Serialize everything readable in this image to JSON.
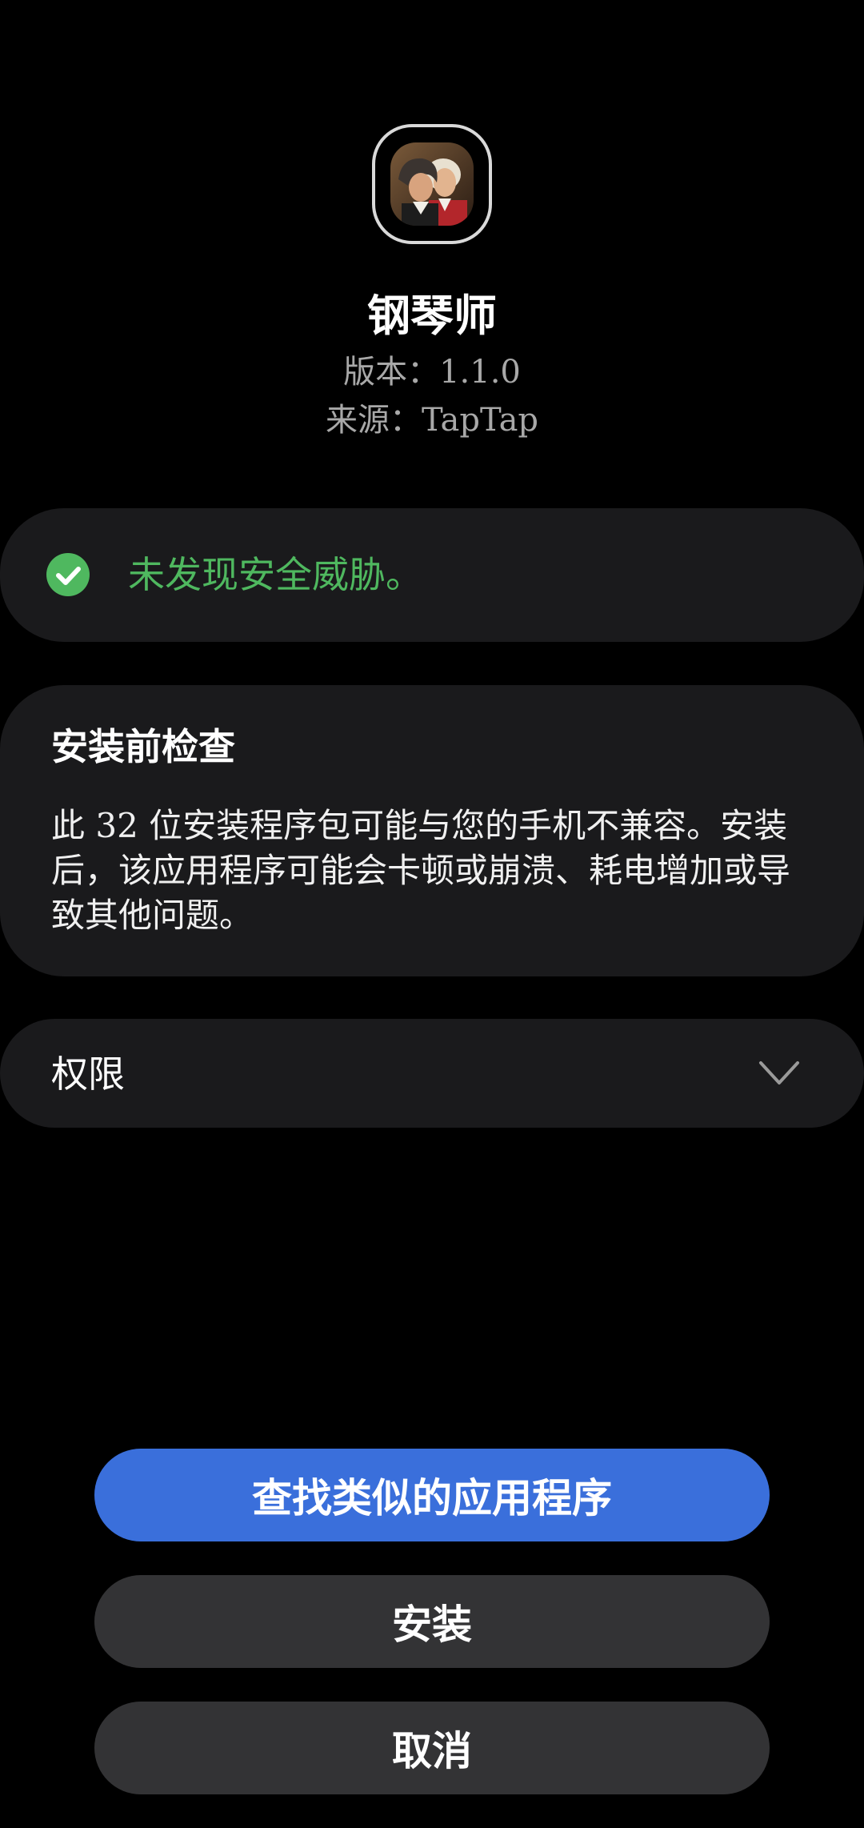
{
  "app": {
    "name": "钢琴师",
    "version_line": "版本：1.1.0",
    "source_line": "来源：TapTap",
    "icon": "composer-portraits-icon"
  },
  "security": {
    "icon": "check-circle-icon",
    "message": "未发现安全威胁。",
    "color": "#4fb85f"
  },
  "precheck": {
    "title": "安装前检查",
    "body": "此 32 位安装程序包可能与您的手机不兼容。安装后，该应用程序可能会卡顿或崩溃、耗电增加或导致其他问题。"
  },
  "permissions": {
    "label": "权限",
    "icon": "chevron-down-icon"
  },
  "buttons": {
    "find_similar": "查找类似的应用程序",
    "install": "安装",
    "cancel": "取消"
  },
  "colors": {
    "background": "#000000",
    "card": "#1a1a1c",
    "primary": "#3a6fdb",
    "secondary_button": "#333335",
    "meta_text": "#a8a8a8"
  }
}
